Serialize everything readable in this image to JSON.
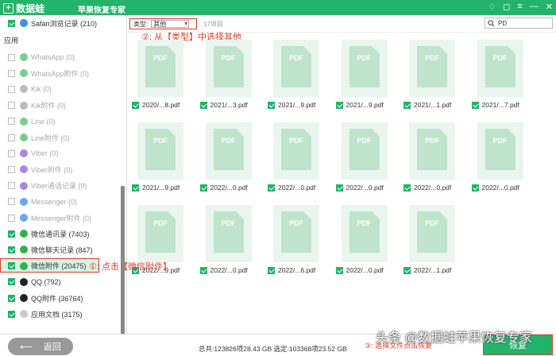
{
  "app": {
    "logo": "数据蛙",
    "title": "苹果恢复专家",
    "controls": [
      "♢",
      "◻",
      "≡",
      "—",
      "✕"
    ]
  },
  "sidebar": {
    "safari": "Safari浏览记录 (210)",
    "section": "应用",
    "items": [
      {
        "label": "WhatsApp (0)",
        "checked": false,
        "disabled": true,
        "color": "#7dcb8c"
      },
      {
        "label": "WhatsApp附件 (0)",
        "checked": false,
        "disabled": true,
        "color": "#7dcb8c"
      },
      {
        "label": "Kik (0)",
        "checked": false,
        "disabled": true,
        "color": "#bbbbbb"
      },
      {
        "label": "Kik附件 (0)",
        "checked": false,
        "disabled": true,
        "color": "#bbbbbb"
      },
      {
        "label": "Line (0)",
        "checked": false,
        "disabled": true,
        "color": "#7dcb8c"
      },
      {
        "label": "Line附件 (0)",
        "checked": false,
        "disabled": true,
        "color": "#7dcb8c"
      },
      {
        "label": "Viber (0)",
        "checked": false,
        "disabled": true,
        "color": "#a98ad8"
      },
      {
        "label": "Viber附件 (0)",
        "checked": false,
        "disabled": true,
        "color": "#a98ad8"
      },
      {
        "label": "Viber通话记录 (0)",
        "checked": false,
        "disabled": true,
        "color": "#a98ad8"
      },
      {
        "label": "Messenger (0)",
        "checked": false,
        "disabled": true,
        "color": "#6aa7e6"
      },
      {
        "label": "Messenger附件 (0)",
        "checked": false,
        "disabled": true,
        "color": "#6aa7e6"
      },
      {
        "label": "微信通讯录 (7403)",
        "checked": true,
        "disabled": false,
        "color": "#2fb24c"
      },
      {
        "label": "微信聊天记录 (847)",
        "checked": true,
        "disabled": false,
        "color": "#2fb24c"
      },
      {
        "label": "微信附件 (20475)",
        "checked": true,
        "disabled": false,
        "color": "#2fb24c"
      },
      {
        "label": "QQ (792)",
        "checked": true,
        "disabled": false,
        "color": "#222222"
      },
      {
        "label": "QQ附件 (36764)",
        "checked": true,
        "disabled": false,
        "color": "#222222"
      },
      {
        "label": "应用文档 (3175)",
        "checked": true,
        "disabled": false,
        "color": "#cccccc"
      }
    ]
  },
  "filter": {
    "type_label": "类型:",
    "type_value": "其他",
    "count": "17项目",
    "search_value": "PD"
  },
  "annotations": {
    "step1": "①: 点击【微信附件】",
    "step2": "②: 从【类型】中选择其他",
    "step3": "③: 选择文件点击恢复"
  },
  "files": [
    "2020/...8.pdf",
    "2021/...3.pdf",
    "2021/...9.pdf",
    "2021/...9.pdf",
    "2021/...1.pdf",
    "2021/...7.pdf",
    "2021/...9.pdf",
    "2022/...0.pdf",
    "2022/...0.pdf",
    "2022/...0.pdf",
    "2022/...0.pdf",
    "2022/...0.pdf",
    "2022/...9.pdf",
    "2022/...0.pdf",
    "2022/...6.pdf",
    "2022/...0.pdf",
    "2022/...1.pdf"
  ],
  "file_thumb_label": "PDF",
  "bottom": {
    "back": "返回",
    "stats": "总共:123826项28.43 GB 选定:103368项23.52 GB",
    "recover": "恢复"
  },
  "watermark": "头条 @数据蛙苹果恢复专家"
}
